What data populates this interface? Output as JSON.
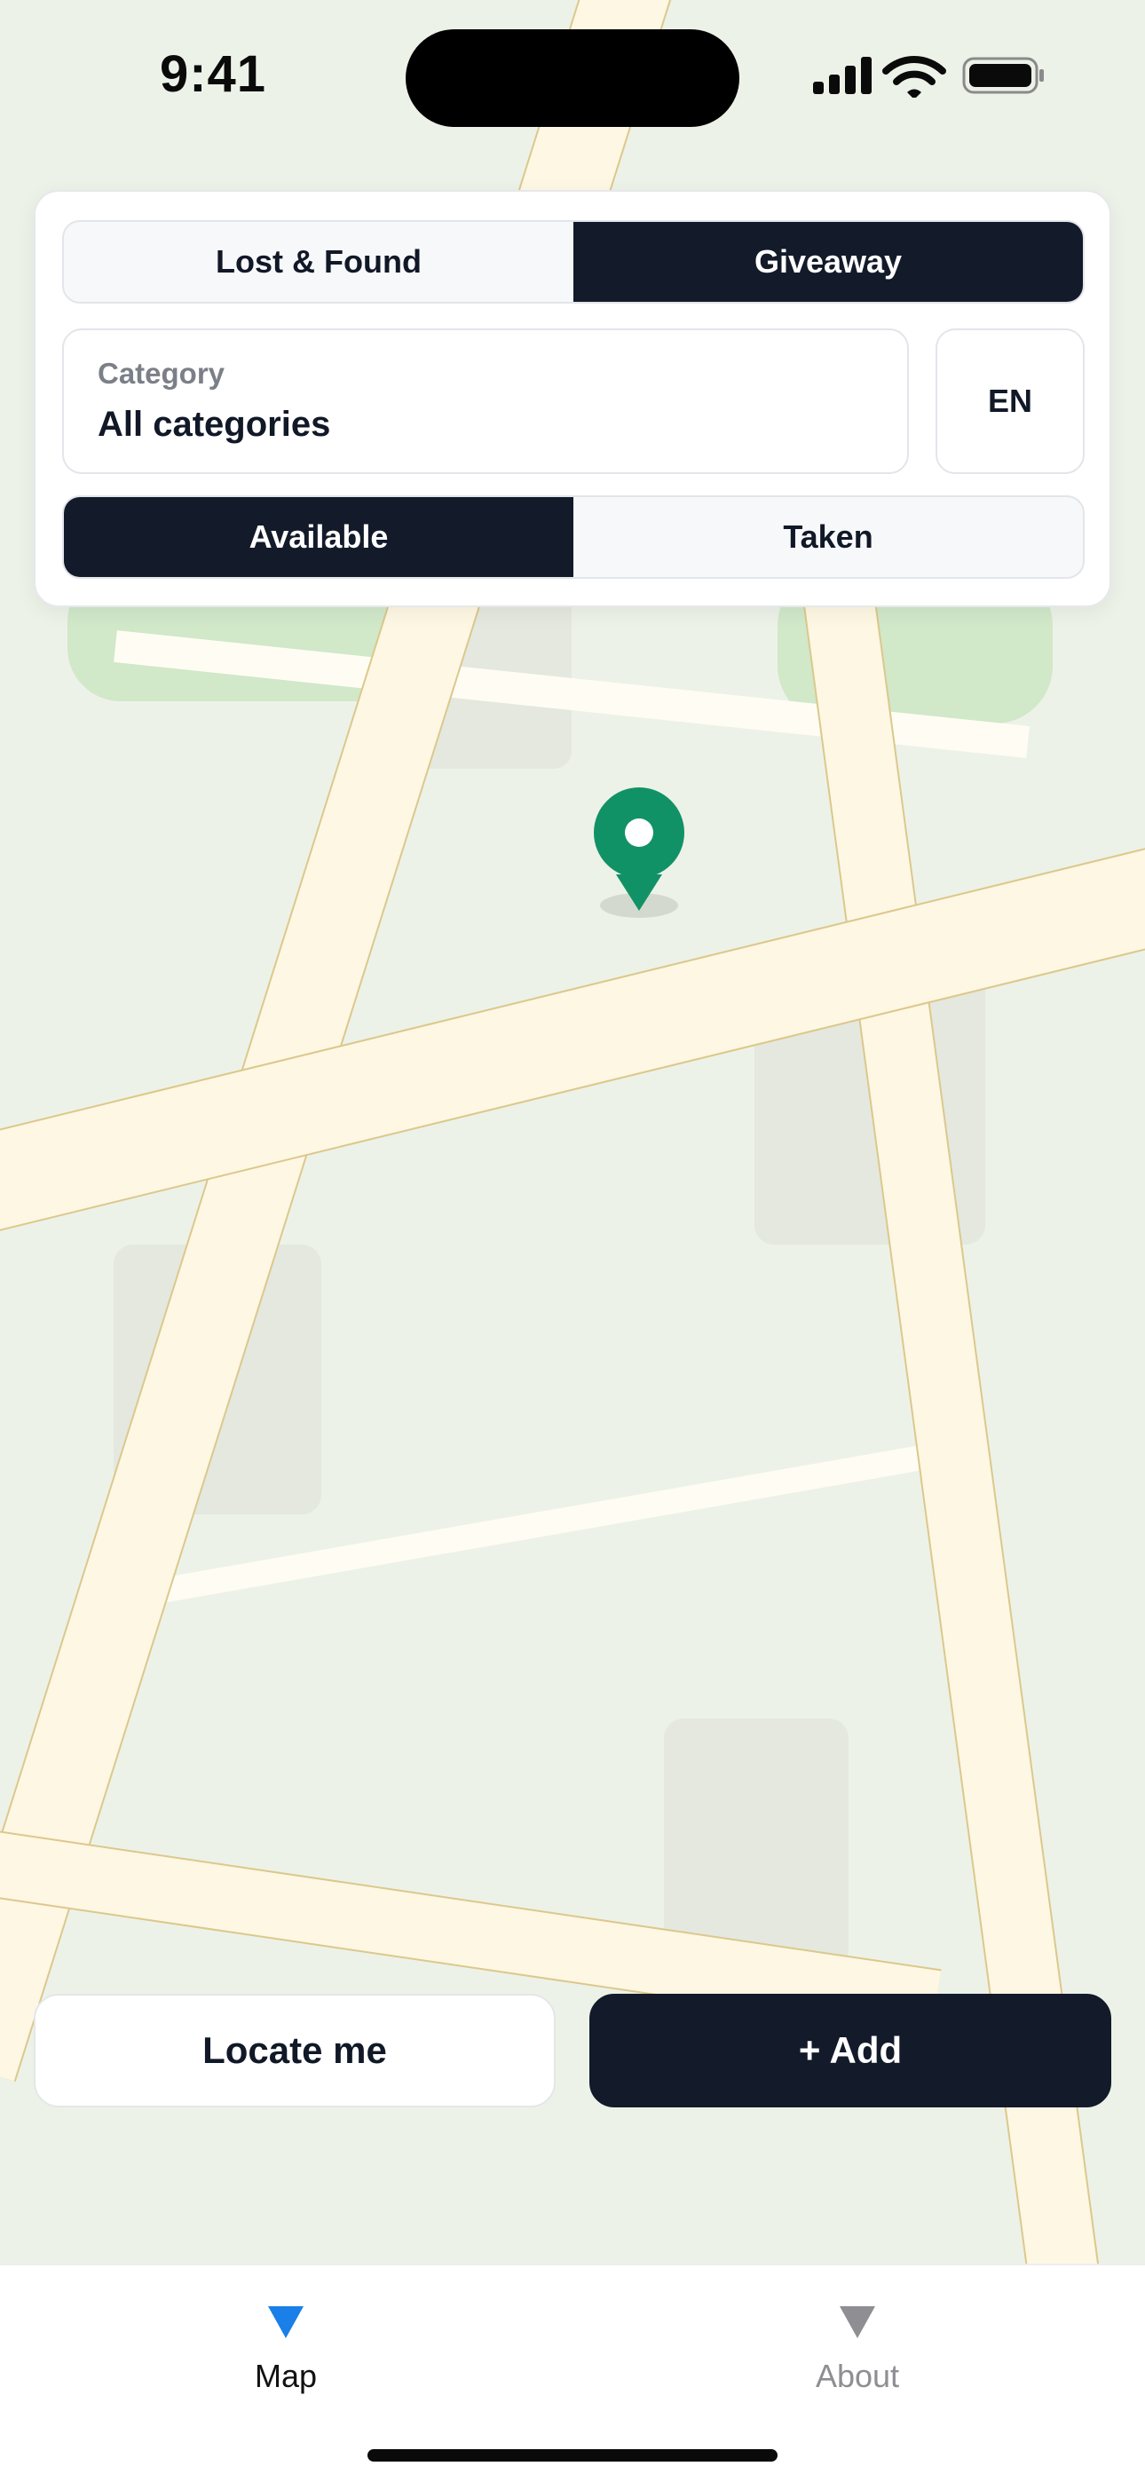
{
  "status_bar": {
    "time": "9:41"
  },
  "filters": {
    "mode_tabs": [
      {
        "label": "Lost & Found",
        "active": false
      },
      {
        "label": "Giveaway",
        "active": true
      }
    ],
    "category": {
      "label": "Category",
      "value": "All categories"
    },
    "language": "EN",
    "status_tabs": [
      {
        "label": "Available",
        "active": true
      },
      {
        "label": "Taken",
        "active": false
      }
    ]
  },
  "actions": {
    "locate_label": "Locate me",
    "add_label": "+ Add"
  },
  "tab_bar": {
    "items": [
      {
        "label": "Map",
        "icon": "triangle-down-icon",
        "active": true
      },
      {
        "label": "About",
        "icon": "triangle-down-icon",
        "active": false
      }
    ]
  },
  "colors": {
    "map_background": "#edf2e8",
    "road_fill": "#fdf7e4",
    "road_edge": "#dcc88c",
    "park": "#d1e8c9",
    "block": "#e4e8df",
    "pin": "#119266",
    "dark": "#131a2a",
    "tab_active": "#1a7fe8",
    "tab_inactive": "#8e8e93"
  }
}
